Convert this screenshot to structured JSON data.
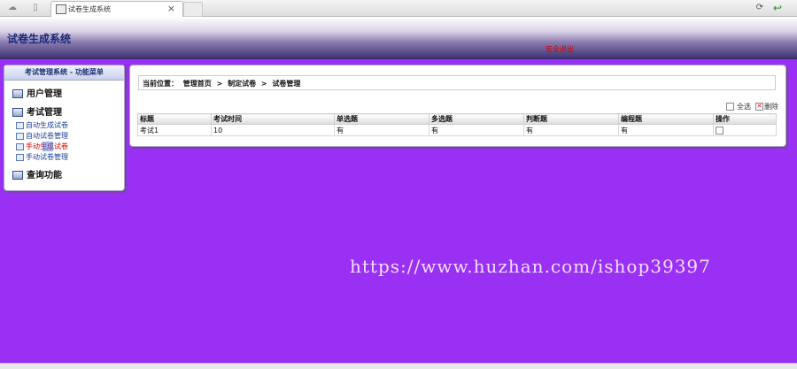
{
  "browser": {
    "tab_title": "试卷生成系统",
    "tab_close": "×",
    "cloud_icon": "cloud-icon",
    "page_icon": "page-icon",
    "refresh_icon": "refresh-icon",
    "back_icon": "back-arrow-icon"
  },
  "header": {
    "title": "试卷生成系统",
    "red_link": "安全退出"
  },
  "sidebar": {
    "heading": "考试管理系统 - 功能菜单",
    "sections": [
      {
        "label": "用户管理"
      },
      {
        "label": "考试管理"
      },
      {
        "label": "查询功能"
      }
    ],
    "sub_items": [
      {
        "label": "自动生成试卷"
      },
      {
        "label": "自动试卷管理"
      },
      {
        "label": "手动生成试卷"
      },
      {
        "label": "手动试卷管理"
      }
    ]
  },
  "breadcrumb": {
    "prefix": "当前位置：",
    "items": [
      "管理首页",
      "制定试卷",
      "试卷管理"
    ],
    "sep": ">"
  },
  "actions": {
    "select_all": "全选",
    "delete": "删除"
  },
  "table": {
    "headers": [
      "标题",
      "考试时间",
      "单选题",
      "多选题",
      "判断题",
      "编程题",
      "操作"
    ],
    "rows": [
      [
        "考试1",
        "10",
        "有",
        "有",
        "有",
        "有",
        ""
      ]
    ]
  },
  "watermark": "https://www.huzhan.com/ishop39397",
  "colors": {
    "background": "#9b30f5",
    "title": "#1a2a7a",
    "active_link": "#d40000"
  }
}
